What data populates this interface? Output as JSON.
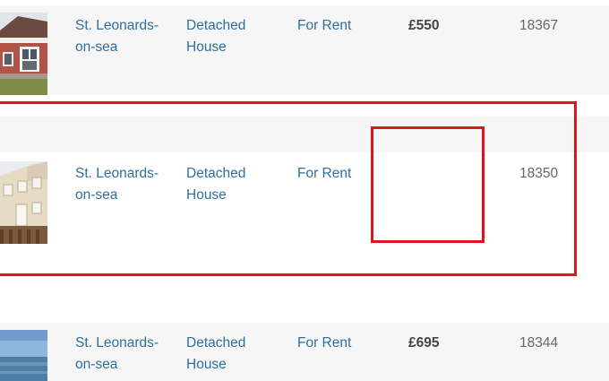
{
  "listings": [
    {
      "town_line1": "St. Leonards-",
      "town_line2": "on-sea",
      "type_line1": "Detached",
      "type_line2": "House",
      "status": "For Rent",
      "price": "£550",
      "ref": "18367"
    },
    {
      "town_line1": "St. Leonards-",
      "town_line2": "on-sea",
      "type_line1": "Detached",
      "type_line2": "House",
      "status": "For Rent",
      "price": "",
      "ref": "18350"
    },
    {
      "town_line1": "St. Leonards-",
      "town_line2": "on-sea",
      "type_line1": "Detached",
      "type_line2": "House",
      "status": "For Rent",
      "price": "£695",
      "ref": "18344"
    }
  ],
  "colors": {
    "link": "#2e6f9e",
    "highlight": "#e0141b",
    "row_alt_bg": "#f6f6f6"
  }
}
